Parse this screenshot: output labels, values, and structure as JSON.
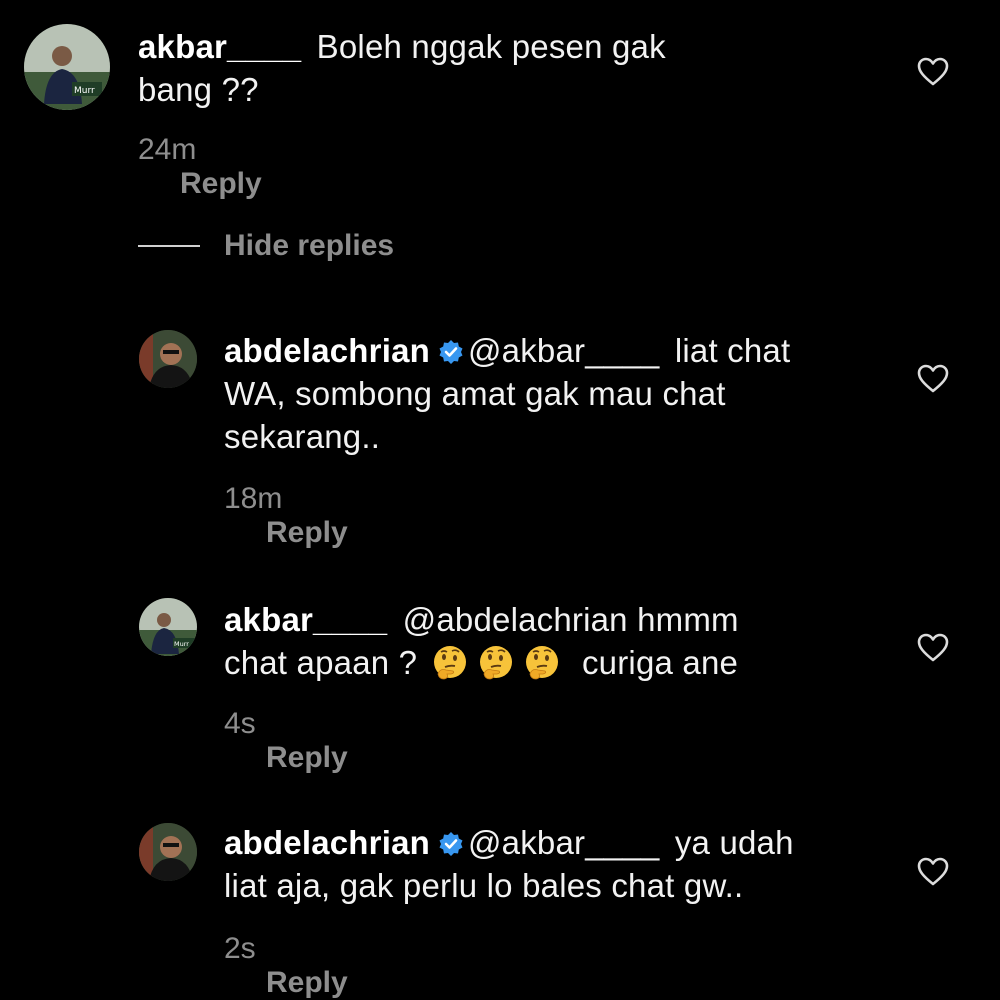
{
  "comments": [
    {
      "username": "akbar____",
      "mention": "",
      "text_line1": "Boleh nggak pesen gak",
      "text_rest": "bang ??",
      "time": "24m",
      "reply_label": "Reply",
      "avatar_label": "Murr"
    },
    {
      "username": "abdelachrian",
      "mention": "@akbar____",
      "text_line1": "liat chat",
      "text_line2": "WA, sombong amat gak mau chat",
      "text_line3": "sekarang..",
      "time": "18m",
      "reply_label": "Reply"
    },
    {
      "username": "akbar____",
      "mention": "@abdelachrian",
      "text_line1": "hmmm",
      "text_line2a": "chat apaan ?",
      "text_line2b": "curiga ane",
      "time": "4s",
      "reply_label": "Reply",
      "avatar_label": "Murr"
    },
    {
      "username": "abdelachrian",
      "mention": "@akbar____",
      "text_line1": "ya udah",
      "text_line2": "liat aja, gak perlu lo bales chat gw..",
      "time": "2s",
      "reply_label": "Reply"
    }
  ],
  "hide_replies_label": "Hide replies",
  "colors": {
    "background": "#000000",
    "text": "#f2f2f2",
    "muted": "#8e8e8e",
    "verified": "#3897f0"
  },
  "icons": {
    "like": "heart-outline-icon",
    "verified": "verified-badge-icon",
    "emoji": "thinking-face-emoji"
  }
}
